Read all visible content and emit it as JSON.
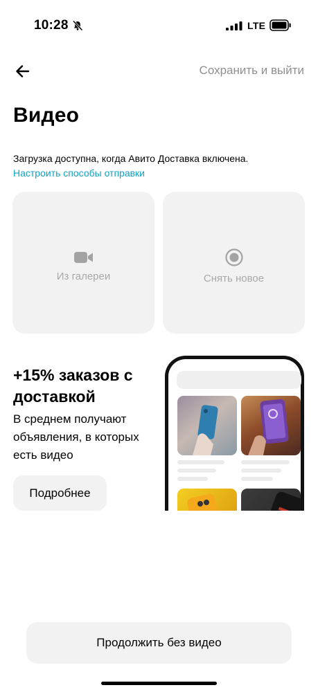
{
  "status_bar": {
    "time": "10:28",
    "network": "LTE",
    "icons": [
      "bell-slash-icon",
      "signal-icon",
      "battery-icon"
    ]
  },
  "header": {
    "back_icon": "arrow-left-icon",
    "save_exit_label": "Сохранить и выйти"
  },
  "page": {
    "title": "Видео",
    "notice": "Загрузка доступна, когда Авито Доставка включена.",
    "link": "Настроить способы отправки"
  },
  "upload_options": [
    {
      "label": "Из галереи",
      "icon": "video-camera-icon"
    },
    {
      "label": "Снять новое",
      "icon": "record-icon"
    }
  ],
  "promo": {
    "title": "+15% заказов с доставкой",
    "description": "В среднем получают объявления, в которых есть видео",
    "button_label": "Подробнее"
  },
  "footer": {
    "continue_label": "Продолжить без видео"
  },
  "colors": {
    "link": "#11a2c8",
    "muted_text": "#8f8f8f",
    "card_bg": "#f2f2f2"
  }
}
